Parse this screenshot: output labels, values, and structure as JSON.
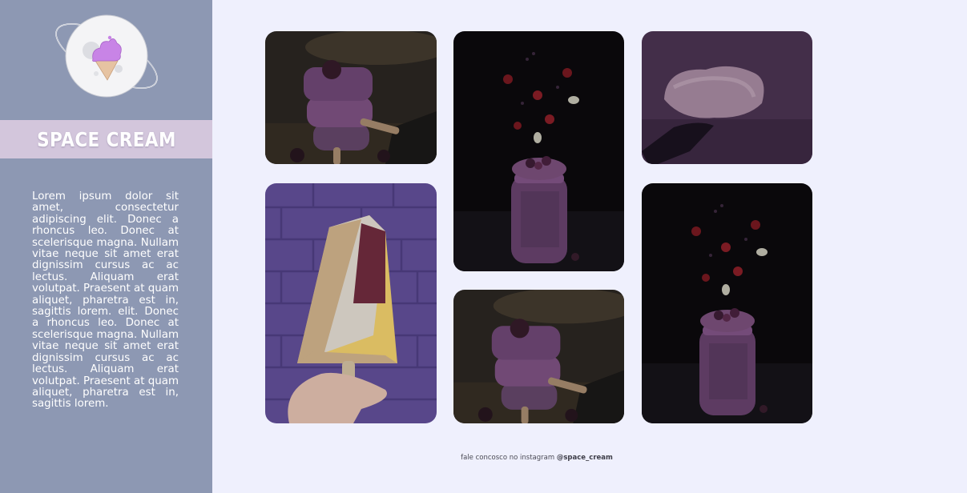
{
  "brand": {
    "title": "SPACE CREAM",
    "logo_icon": "ice-cream-planet-icon"
  },
  "sidebar": {
    "description": "Lorem ipsum dolor sit amet, consectetur adipiscing elit. Donec a rhoncus leo. Donec at scelerisque magna. Nullam vitae neque sit amet erat dignissim cursus ac ac lectus. Aliquam erat volutpat. Praesent at quam aliquet, pharetra est in, sagittis lorem. elit. Donec a rhoncus leo. Donec at scelerisque magna. Nullam vitae neque sit amet erat dignissim cursus ac ac lectus. Aliquam erat volutpat. Praesent at quam aliquet, pharetra est in, sagittis lorem."
  },
  "gallery": {
    "photos": [
      {
        "subject": "stacked-popsicles-photo"
      },
      {
        "subject": "smoothie-jar-with-berries-photo"
      },
      {
        "subject": "ice-cream-scoop-photo"
      },
      {
        "subject": "nut-popsicle-in-hand-photo"
      },
      {
        "subject": "stacked-popsicles-photo"
      },
      {
        "subject": "smoothie-jar-with-berries-photo"
      }
    ]
  },
  "footer": {
    "text": "fale concosco no instagram",
    "handle": "@space_cream"
  },
  "colors": {
    "page_background": "#eff0fd",
    "sidebar_background": "#8d98b3",
    "brand_band": "#d3c6dc"
  }
}
